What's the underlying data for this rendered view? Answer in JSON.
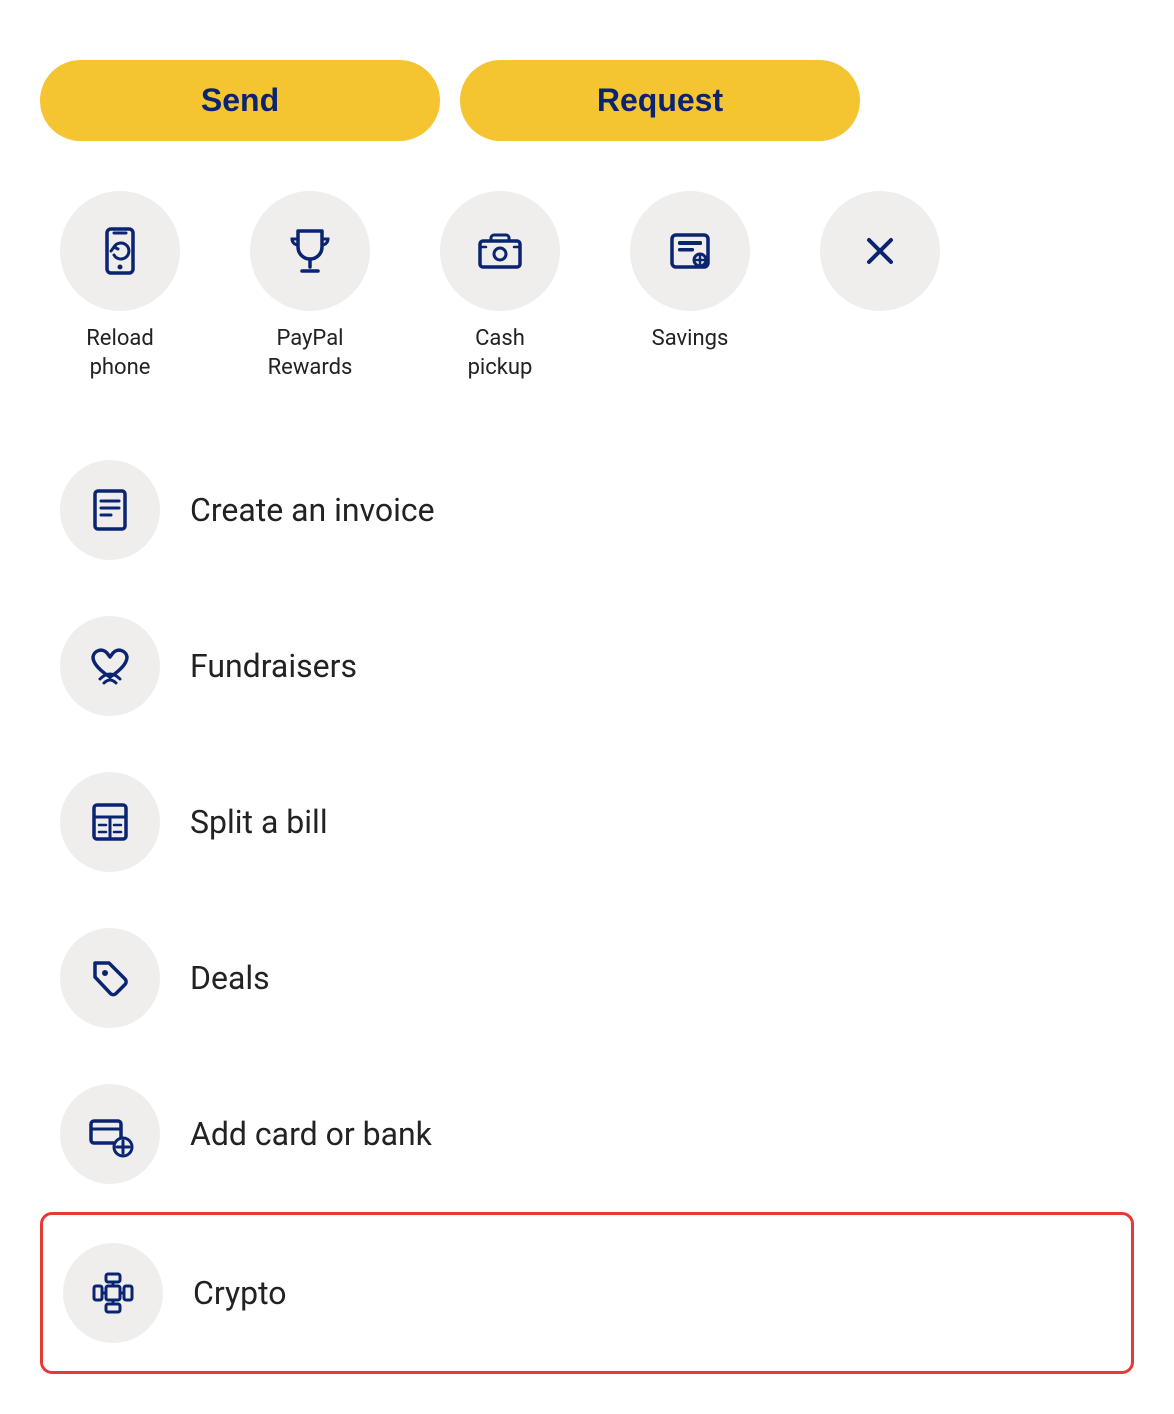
{
  "buttons": {
    "send": "Send",
    "request": "Request"
  },
  "quickActions": [
    {
      "id": "reload-phone",
      "label": "Reload\nphone",
      "icon": "reload-phone-icon"
    },
    {
      "id": "paypal-rewards",
      "label": "PayPal\nRewards",
      "icon": "trophy-icon"
    },
    {
      "id": "cash-pickup",
      "label": "Cash\npickup",
      "icon": "cash-pickup-icon"
    },
    {
      "id": "savings",
      "label": "Savings",
      "icon": "savings-icon"
    },
    {
      "id": "close",
      "label": "",
      "icon": "close-icon"
    }
  ],
  "menuItems": [
    {
      "id": "create-invoice",
      "label": "Create an invoice",
      "icon": "invoice-icon",
      "highlighted": false
    },
    {
      "id": "fundraisers",
      "label": "Fundraisers",
      "icon": "fundraisers-icon",
      "highlighted": false
    },
    {
      "id": "split-bill",
      "label": "Split a bill",
      "icon": "split-bill-icon",
      "highlighted": false
    },
    {
      "id": "deals",
      "label": "Deals",
      "icon": "deals-icon",
      "highlighted": false
    },
    {
      "id": "add-card-bank",
      "label": "Add card or bank",
      "icon": "add-card-icon",
      "highlighted": false
    },
    {
      "id": "crypto",
      "label": "Crypto",
      "icon": "crypto-icon",
      "highlighted": true
    }
  ]
}
